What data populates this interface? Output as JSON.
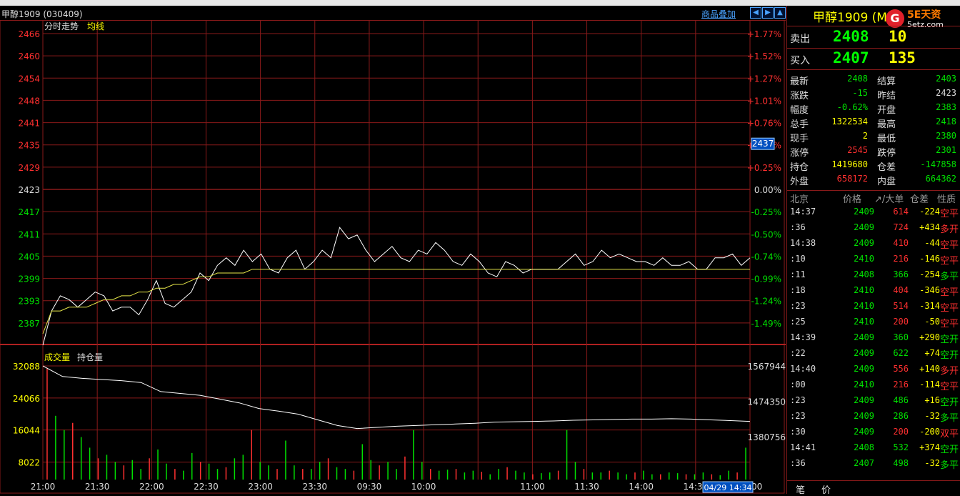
{
  "chart": {
    "title": "甲醇1909 (030409)",
    "overlay_label": "商品叠加",
    "nav_buttons": [
      "◀",
      "▶",
      "▲"
    ],
    "price_legend": [
      "分时走势",
      "均线"
    ],
    "vol_legend": [
      "成交量",
      "持仓量"
    ],
    "price_ticks": [
      "2466",
      "2460",
      "2454",
      "2448",
      "2441",
      "2435",
      "2429",
      "2423",
      "2417",
      "2411",
      "2405",
      "2399",
      "2393",
      "2387"
    ],
    "pct_ticks": [
      "+1.77%",
      "+1.52%",
      "+1.27%",
      "+1.01%",
      "+0.76%",
      "+0.51%",
      "+0.25%",
      "0.00%",
      "-0.25%",
      "-0.50%",
      "-0.74%",
      "-0.99%",
      "-1.24%",
      "-1.49%"
    ],
    "vol_ticks": [
      "32088",
      "24066",
      "16044",
      "8022"
    ],
    "oi_ticks": [
      "1567944",
      "1474350",
      "1380756"
    ],
    "time_labels": [
      "21:00",
      "21:30",
      "22:00",
      "22:30",
      "23:00",
      "23:30",
      "09:30",
      "10:00",
      "",
      "11:00",
      "11:30",
      "14:00",
      "14:30",
      "15:00"
    ],
    "current_price_tag": "2437",
    "cursor_time": "04/29 14:34"
  },
  "chart_data": [
    {
      "type": "line",
      "title": "分时走势",
      "series": [
        {
          "name": "分时走势",
          "values": [
            2384,
            2393,
            2397,
            2396,
            2394,
            2396,
            2398,
            2397,
            2393,
            2394,
            2394,
            2392,
            2396,
            2401,
            2395,
            2394,
            2396,
            2398,
            2403,
            2401,
            2405,
            2407,
            2405,
            2409,
            2406,
            2408,
            2404,
            2403,
            2407,
            2409,
            2404,
            2406,
            2409,
            2407,
            2415,
            2412,
            2413,
            2409,
            2406,
            2408,
            2410,
            2407,
            2406,
            2409,
            2408,
            2411,
            2409,
            2406,
            2405,
            2408,
            2406,
            2403,
            2402,
            2406,
            2405,
            2403,
            2404,
            2404,
            2404,
            2404,
            2406,
            2408,
            2405,
            2406,
            2409,
            2407,
            2408,
            2407,
            2406,
            2406,
            2405,
            2407,
            2405,
            2405,
            2406,
            2404,
            2404,
            2407,
            2407,
            2408,
            2405,
            2407
          ]
        },
        {
          "name": "均线",
          "values": [
            2387,
            2393,
            2393,
            2394,
            2394,
            2394,
            2395,
            2396,
            2396,
            2397,
            2397,
            2398,
            2398,
            2399,
            2399,
            2400,
            2400,
            2401,
            2402,
            2402,
            2403,
            2403,
            2403,
            2403,
            2404,
            2404,
            2404,
            2404,
            2404,
            2404,
            2404,
            2404,
            2404,
            2404,
            2404,
            2404,
            2404,
            2404,
            2404,
            2404,
            2404,
            2404,
            2404,
            2404,
            2404,
            2404,
            2404,
            2404,
            2404,
            2404,
            2404,
            2404,
            2404,
            2404,
            2404,
            2404,
            2404,
            2404,
            2404,
            2404,
            2404,
            2404,
            2404,
            2404,
            2404,
            2404,
            2404,
            2404,
            2404,
            2404,
            2404,
            2404,
            2404,
            2404,
            2404,
            2404,
            2404,
            2404,
            2404,
            2404,
            2404,
            2404
          ]
        }
      ],
      "ylim": [
        2384,
        2466
      ],
      "grid": true
    },
    {
      "type": "bar",
      "title": "成交量",
      "series": [
        {
          "name": "成交量",
          "values": [
            31500,
            18000,
            14000,
            16000,
            12000,
            9000,
            6000,
            7000,
            5000,
            4000,
            5500,
            3000,
            6000,
            8500,
            4500,
            3000,
            2500,
            7500,
            5000,
            4500,
            3000,
            3500,
            6000,
            7000,
            14000,
            5000,
            4000,
            3000,
            11000,
            4000,
            3000,
            3000,
            5000,
            6000,
            3500,
            3000,
            2500,
            10000,
            5500,
            4000,
            5000,
            3000,
            6500,
            14000,
            5000,
            3000,
            2500,
            2800,
            3000,
            2000,
            2500,
            2200,
            1500,
            3000,
            3500,
            2500,
            2000,
            1500,
            1800,
            2000,
            2500,
            14000,
            5000,
            3000,
            2000,
            2000,
            2500,
            2000,
            1500,
            2000,
            2500,
            1500,
            1500,
            2000,
            1800,
            1500,
            1500,
            2000,
            1500,
            1200,
            2500,
            2000,
            9000
          ]
        },
        {
          "name": "持仓量",
          "values": [
            1567944,
            1540000,
            1535000,
            1532000,
            1529000,
            1524000,
            1500000,
            1495000,
            1490000,
            1480000,
            1470000,
            1455000,
            1448000,
            1440000,
            1425000,
            1410000,
            1402000,
            1405000,
            1408000,
            1410000,
            1412000,
            1414000,
            1416000,
            1419000,
            1420000,
            1421000,
            1422000,
            1424000,
            1425000,
            1426000,
            1427000,
            1427000,
            1428000,
            1427000,
            1425000,
            1423000,
            1421000
          ]
        }
      ],
      "ylim": [
        0,
        32088
      ]
    }
  ],
  "quote": {
    "title": "甲醇1909 (M",
    "logo_char": "G",
    "logo_text1": "5E天资",
    "logo_text2": "5etz.com",
    "ask_label": "卖出",
    "ask_price": "2408",
    "ask_vol": "10",
    "bid_label": "买入",
    "bid_price": "2407",
    "bid_vol": "135"
  },
  "stats": [
    {
      "l1": "最新",
      "v1": "2408",
      "c1": "green",
      "l2": "结算",
      "v2": "2403",
      "c2": "green"
    },
    {
      "l1": "涨跌",
      "v1": "-15",
      "c1": "green",
      "l2": "昨结",
      "v2": "2423",
      "c2": "white"
    },
    {
      "l1": "幅度",
      "v1": "-0.62%",
      "c1": "green",
      "l2": "开盘",
      "v2": "2383",
      "c2": "green"
    },
    {
      "l1": "总手",
      "v1": "1322534",
      "c1": "yellow",
      "l2": "最高",
      "v2": "2418",
      "c2": "green"
    },
    {
      "l1": "现手",
      "v1": "2",
      "c1": "yellow",
      "l2": "最低",
      "v2": "2380",
      "c2": "green"
    },
    {
      "l1": "涨停",
      "v1": "2545",
      "c1": "red",
      "l2": "跌停",
      "v2": "2301",
      "c2": "green"
    },
    {
      "l1": "持仓",
      "v1": "1419680",
      "c1": "yellow",
      "l2": "仓差",
      "v2": "-147858",
      "c2": "green"
    },
    {
      "l1": "外盘",
      "v1": "658172",
      "c1": "red",
      "l2": "内盘",
      "v2": "664362",
      "c2": "green"
    }
  ],
  "ticks_header": {
    "time": "北京",
    "price": "价格",
    "vol": "↗/大单",
    "oi": "仓差",
    "type": "性质"
  },
  "ticks": [
    {
      "time": "14:37",
      "tc": "white",
      "price": "2409",
      "vol": "614",
      "vc": "red",
      "oi": "-224",
      "type": "空平",
      "typec": "red"
    },
    {
      "time": ":36",
      "tc": "white",
      "price": "2409",
      "vol": "724",
      "vc": "red",
      "oi": "+434",
      "type": "多开",
      "typec": "red"
    },
    {
      "time": "14:38",
      "tc": "white",
      "price": "2409",
      "vol": "410",
      "vc": "red",
      "oi": "-44",
      "type": "空平",
      "typec": "red"
    },
    {
      "time": ":10",
      "tc": "white",
      "price": "2410",
      "vol": "216",
      "vc": "red",
      "oi": "-146",
      "type": "空平",
      "typec": "red"
    },
    {
      "time": ":11",
      "tc": "white",
      "price": "2408",
      "vol": "366",
      "vc": "green",
      "oi": "-254",
      "type": "多平",
      "typec": "green"
    },
    {
      "time": ":18",
      "tc": "white",
      "price": "2410",
      "vol": "404",
      "vc": "red",
      "oi": "-346",
      "type": "空平",
      "typec": "red"
    },
    {
      "time": ":23",
      "tc": "white",
      "price": "2410",
      "vol": "514",
      "vc": "red",
      "oi": "-314",
      "type": "空平",
      "typec": "red"
    },
    {
      "time": ":25",
      "tc": "white",
      "price": "2410",
      "vol": "200",
      "vc": "red",
      "oi": "-50",
      "type": "空平",
      "typec": "red"
    },
    {
      "time": "14:39",
      "tc": "white",
      "price": "2409",
      "vol": "360",
      "vc": "green",
      "oi": "+290",
      "type": "空开",
      "typec": "green"
    },
    {
      "time": ":22",
      "tc": "white",
      "price": "2409",
      "vol": "622",
      "vc": "green",
      "oi": "+74",
      "type": "空开",
      "typec": "green"
    },
    {
      "time": "14:40",
      "tc": "white",
      "price": "2409",
      "vol": "556",
      "vc": "red",
      "oi": "+140",
      "type": "多开",
      "typec": "red"
    },
    {
      "time": ":00",
      "tc": "white",
      "price": "2410",
      "vol": "216",
      "vc": "red",
      "oi": "-114",
      "type": "空平",
      "typec": "red"
    },
    {
      "time": ":23",
      "tc": "white",
      "price": "2409",
      "vol": "486",
      "vc": "green",
      "oi": "+16",
      "type": "空开",
      "typec": "green"
    },
    {
      "time": ":23",
      "tc": "white",
      "price": "2409",
      "vol": "286",
      "vc": "green",
      "oi": "-32",
      "type": "多平",
      "typec": "green"
    },
    {
      "time": ":30",
      "tc": "white",
      "price": "2409",
      "vol": "200",
      "vc": "red",
      "oi": "-200",
      "type": "双平",
      "typec": "red"
    },
    {
      "time": "14:41",
      "tc": "white",
      "price": "2408",
      "vol": "532",
      "vc": "green",
      "oi": "+374",
      "type": "空开",
      "typec": "green"
    },
    {
      "time": ":36",
      "tc": "white",
      "price": "2407",
      "vol": "498",
      "vc": "green",
      "oi": "-32",
      "type": "多平",
      "typec": "green"
    }
  ],
  "tabs": [
    "笔",
    "价"
  ],
  "colors": {
    "up": "#ff3030",
    "down": "#00e000",
    "flat": "#dddddd",
    "grid": "#8a1a1a",
    "price_line": "#ffffff",
    "avg_line": "#e8e84a",
    "accent": "#4aa3ff"
  }
}
